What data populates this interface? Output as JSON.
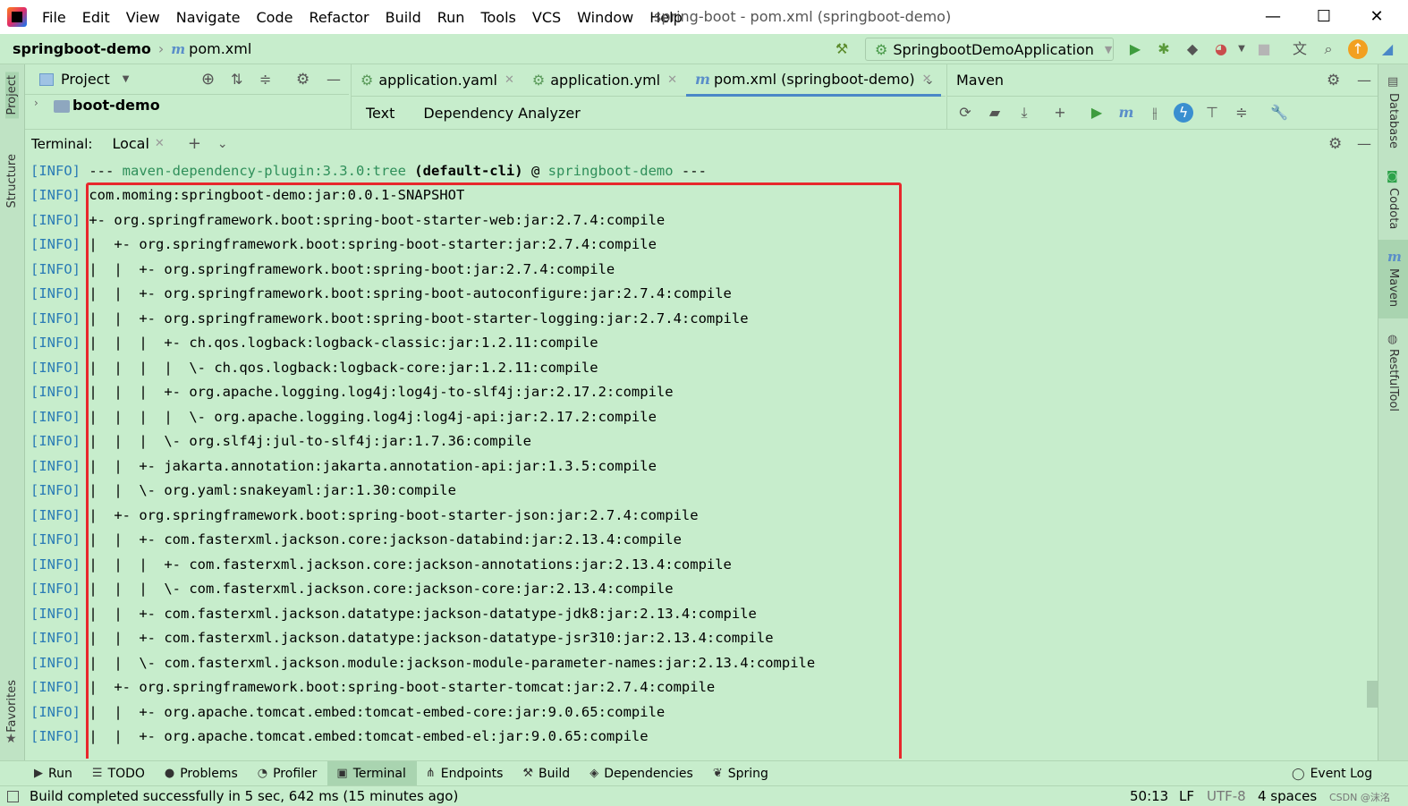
{
  "menu": [
    "File",
    "Edit",
    "View",
    "Navigate",
    "Code",
    "Refactor",
    "Build",
    "Run",
    "Tools",
    "VCS",
    "Window",
    "Help"
  ],
  "window_title": "spring-boot - pom.xml (springboot-demo)",
  "window_controls": {
    "minimize": "—",
    "maximize": "☐",
    "close": "✕"
  },
  "breadcrumb": {
    "project": "springboot-demo",
    "file": "pom.xml"
  },
  "run_config": "SpringbootDemoApplication",
  "left_stripe": {
    "project": "Project",
    "structure": "Structure",
    "favorites": "Favorites"
  },
  "right_stripe": {
    "database": "Database",
    "codota": "Codota",
    "maven": "Maven",
    "restful": "RestfulTool"
  },
  "project_panel": {
    "title": "Project",
    "tree_item": "boot-demo"
  },
  "editor_tabs": [
    {
      "label": "application.yaml"
    },
    {
      "label": "application.yml"
    },
    {
      "label": "pom.xml (springboot-demo)"
    }
  ],
  "sub_tabs": [
    "Text",
    "Dependency Analyzer"
  ],
  "maven_panel": {
    "title": "Maven"
  },
  "terminal": {
    "label": "Terminal:",
    "tab": "Local",
    "header_line": {
      "prefix": "[INFO]",
      "dashes": " --- ",
      "plugin": "maven-dependency-plugin:3.3.0:tree",
      "goal": " (default-cli)",
      "at": " @ ",
      "project": "springboot-demo",
      "tail": " ---"
    },
    "lines": [
      "com.moming:springboot-demo:jar:0.0.1-SNAPSHOT",
      "+- org.springframework.boot:spring-boot-starter-web:jar:2.7.4:compile",
      "|  +- org.springframework.boot:spring-boot-starter:jar:2.7.4:compile",
      "|  |  +- org.springframework.boot:spring-boot:jar:2.7.4:compile",
      "|  |  +- org.springframework.boot:spring-boot-autoconfigure:jar:2.7.4:compile",
      "|  |  +- org.springframework.boot:spring-boot-starter-logging:jar:2.7.4:compile",
      "|  |  |  +- ch.qos.logback:logback-classic:jar:1.2.11:compile",
      "|  |  |  |  \\- ch.qos.logback:logback-core:jar:1.2.11:compile",
      "|  |  |  +- org.apache.logging.log4j:log4j-to-slf4j:jar:2.17.2:compile",
      "|  |  |  |  \\- org.apache.logging.log4j:log4j-api:jar:2.17.2:compile",
      "|  |  |  \\- org.slf4j:jul-to-slf4j:jar:1.7.36:compile",
      "|  |  +- jakarta.annotation:jakarta.annotation-api:jar:1.3.5:compile",
      "|  |  \\- org.yaml:snakeyaml:jar:1.30:compile",
      "|  +- org.springframework.boot:spring-boot-starter-json:jar:2.7.4:compile",
      "|  |  +- com.fasterxml.jackson.core:jackson-databind:jar:2.13.4:compile",
      "|  |  |  +- com.fasterxml.jackson.core:jackson-annotations:jar:2.13.4:compile",
      "|  |  |  \\- com.fasterxml.jackson.core:jackson-core:jar:2.13.4:compile",
      "|  |  +- com.fasterxml.jackson.datatype:jackson-datatype-jdk8:jar:2.13.4:compile",
      "|  |  +- com.fasterxml.jackson.datatype:jackson-datatype-jsr310:jar:2.13.4:compile",
      "|  |  \\- com.fasterxml.jackson.module:jackson-module-parameter-names:jar:2.13.4:compile",
      "|  +- org.springframework.boot:spring-boot-starter-tomcat:jar:2.7.4:compile",
      "|  |  +- org.apache.tomcat.embed:tomcat-embed-core:jar:9.0.65:compile",
      "|  |  +- org.apache.tomcat.embed:tomcat-embed-el:jar:9.0.65:compile"
    ],
    "info_prefix": "[INFO]"
  },
  "bottom_tools": [
    "Run",
    "TODO",
    "Problems",
    "Profiler",
    "Terminal",
    "Endpoints",
    "Build",
    "Dependencies",
    "Spring"
  ],
  "event_log": "Event Log",
  "status": {
    "message": "Build completed successfully in 5 sec, 642 ms (15 minutes ago)",
    "position": "50:13",
    "line_sep": "LF",
    "encoding": "UTF-8",
    "indent": "4 spaces",
    "watermark": "CSDN @沫洺"
  },
  "colors": {
    "background": "#c7edcc",
    "info": "#2a7bb5",
    "plugin": "#2f8f5a",
    "highlight": "#e8282c"
  }
}
